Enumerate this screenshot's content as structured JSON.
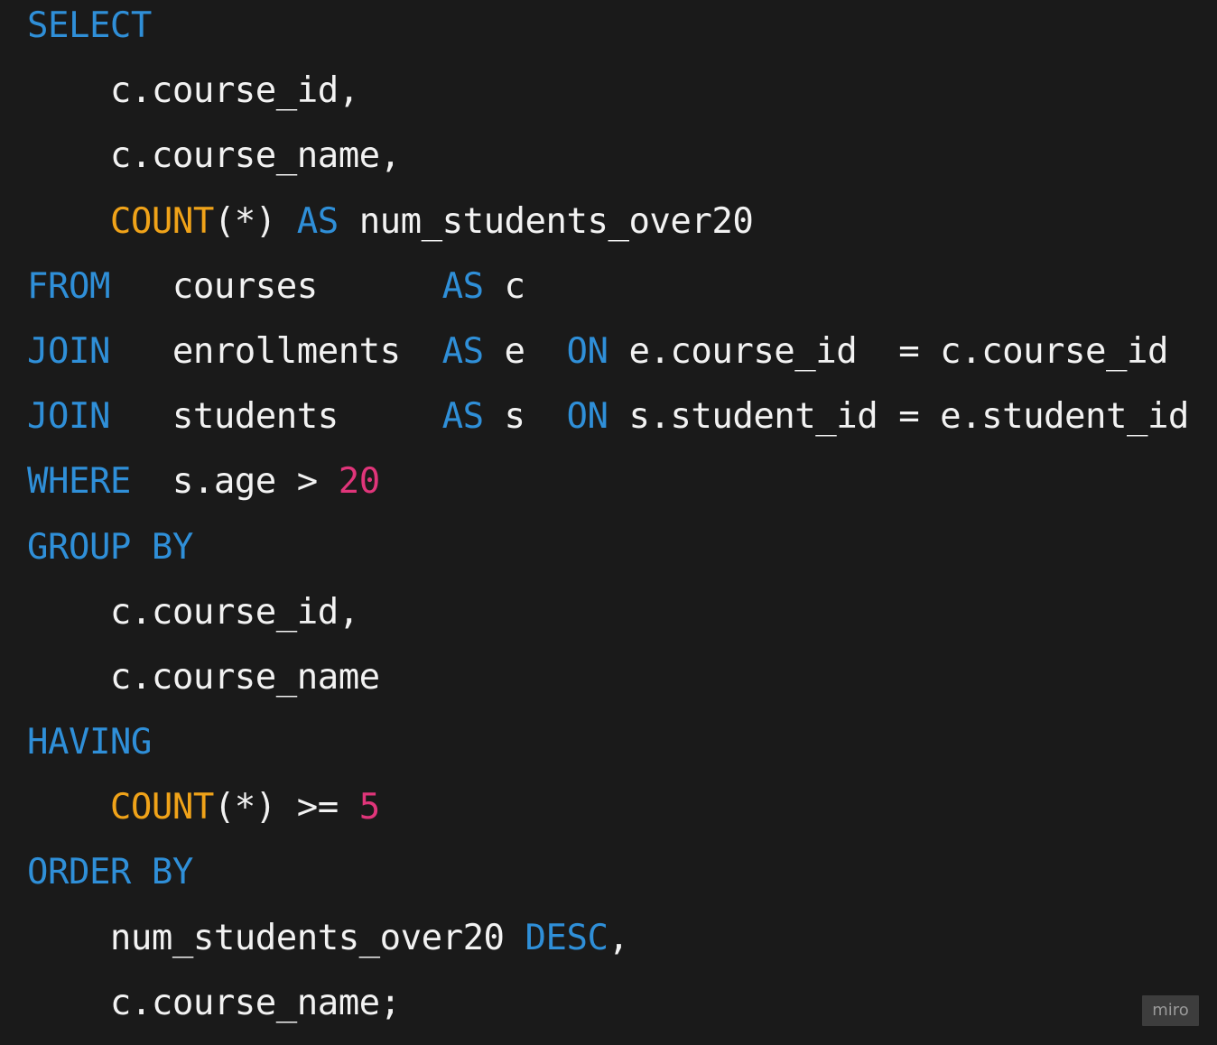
{
  "code_lines": [
    [
      {
        "t": "SELECT",
        "c": "kw"
      }
    ],
    [
      {
        "t": "    c.course_id,",
        "c": "pl"
      }
    ],
    [
      {
        "t": "    c.course_name,",
        "c": "pl"
      }
    ],
    [
      {
        "t": "    ",
        "c": "pl"
      },
      {
        "t": "COUNT",
        "c": "fn"
      },
      {
        "t": "(*) ",
        "c": "pl"
      },
      {
        "t": "AS",
        "c": "kw"
      },
      {
        "t": " num_students_over20",
        "c": "pl"
      }
    ],
    [
      {
        "t": "FROM",
        "c": "kw"
      },
      {
        "t": "   courses      ",
        "c": "pl"
      },
      {
        "t": "AS",
        "c": "kw"
      },
      {
        "t": " c",
        "c": "pl"
      }
    ],
    [
      {
        "t": "JOIN",
        "c": "kw"
      },
      {
        "t": "   enrollments  ",
        "c": "pl"
      },
      {
        "t": "AS",
        "c": "kw"
      },
      {
        "t": " e  ",
        "c": "pl"
      },
      {
        "t": "ON",
        "c": "kw"
      },
      {
        "t": " e.course_id  = c.course_id",
        "c": "pl"
      }
    ],
    [
      {
        "t": "JOIN",
        "c": "kw"
      },
      {
        "t": "   students     ",
        "c": "pl"
      },
      {
        "t": "AS",
        "c": "kw"
      },
      {
        "t": " s  ",
        "c": "pl"
      },
      {
        "t": "ON",
        "c": "kw"
      },
      {
        "t": " s.student_id = e.student_id",
        "c": "pl"
      }
    ],
    [
      {
        "t": "WHERE",
        "c": "kw"
      },
      {
        "t": "  s.age > ",
        "c": "pl"
      },
      {
        "t": "20",
        "c": "num"
      }
    ],
    [
      {
        "t": "GROUP BY",
        "c": "kw"
      }
    ],
    [
      {
        "t": "    c.course_id,",
        "c": "pl"
      }
    ],
    [
      {
        "t": "    c.course_name",
        "c": "pl"
      }
    ],
    [
      {
        "t": "HAVING",
        "c": "kw"
      }
    ],
    [
      {
        "t": "    ",
        "c": "pl"
      },
      {
        "t": "COUNT",
        "c": "fn"
      },
      {
        "t": "(*) >= ",
        "c": "pl"
      },
      {
        "t": "5",
        "c": "num"
      }
    ],
    [
      {
        "t": "ORDER BY",
        "c": "kw"
      }
    ],
    [
      {
        "t": "    num_students_over20 ",
        "c": "pl"
      },
      {
        "t": "DESC",
        "c": "kw"
      },
      {
        "t": ",",
        "c": "pl"
      }
    ],
    [
      {
        "t": "    c.course_name;",
        "c": "pl"
      }
    ]
  ],
  "watermark": "miro"
}
